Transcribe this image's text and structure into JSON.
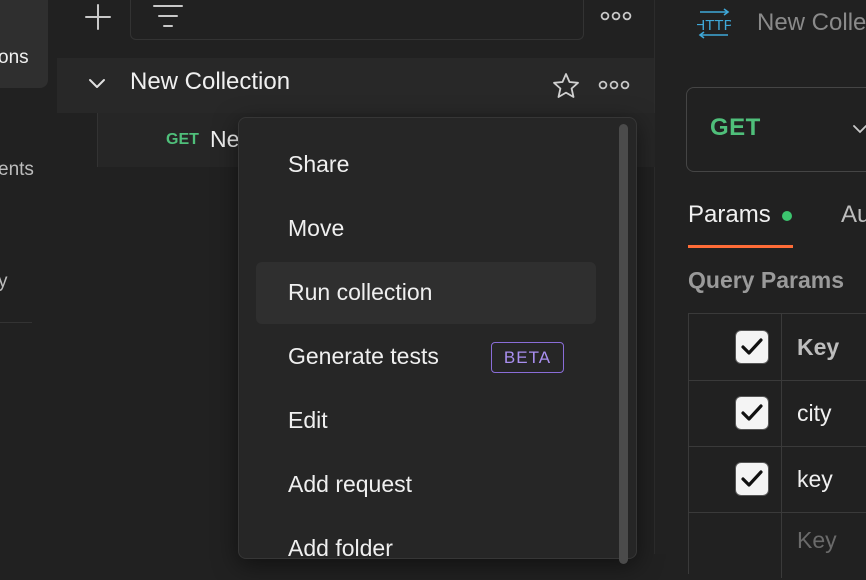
{
  "left_nav": {
    "items": [
      {
        "label": "ons",
        "active": true
      },
      {
        "label": "ents"
      },
      {
        "label": "y"
      }
    ]
  },
  "sidebar": {
    "add_icon": "plus-icon",
    "filter_icon": "filter-icon",
    "more_icon": "more-horizontal-icon",
    "collection": {
      "title": "New Collection",
      "chevron_icon": "chevron-down-icon",
      "star_icon": "star-icon",
      "more_icon": "more-horizontal-icon"
    },
    "request": {
      "method": "GET",
      "name": "Ne"
    }
  },
  "context_menu": {
    "items": [
      {
        "label": "Share"
      },
      {
        "label": "Move"
      },
      {
        "label": "Run collection",
        "highlighted": true
      },
      {
        "label": "Generate tests",
        "badge": "BETA"
      },
      {
        "label": "Edit"
      },
      {
        "label": "Add request"
      },
      {
        "label": "Add folder"
      }
    ]
  },
  "request_pane": {
    "tab": {
      "icon": "http-icon",
      "icon_text": "HTTP",
      "title": "New Colle"
    },
    "method": "GET",
    "method_chevron_icon": "chevron-down-icon",
    "tabs": [
      {
        "label": "Params",
        "active": true,
        "has_dot": true
      },
      {
        "label": "Au"
      }
    ],
    "query_params_title": "Query Params",
    "params_table": {
      "header": {
        "key": "Key",
        "checked": true
      },
      "rows": [
        {
          "key": "city",
          "checked": true
        },
        {
          "key": "key",
          "checked": true
        }
      ],
      "placeholder_row": {
        "key": "Key"
      }
    }
  },
  "colors": {
    "background": "#212121",
    "get_method": "#4fbf7a",
    "beta_badge": "#8a6dd8",
    "active_tab_underline": "#ff6c37",
    "params_dot": "#3cc46e"
  }
}
